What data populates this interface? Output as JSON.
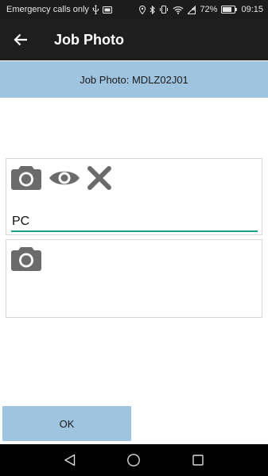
{
  "status_bar": {
    "carrier_text": "Emergency calls only",
    "battery_percent": "72%",
    "time": "09:15",
    "icons": [
      "usb-icon",
      "sim-icon",
      "location-icon",
      "bluetooth-icon",
      "vibrate-icon",
      "wifi-icon",
      "signal-icon",
      "battery-icon"
    ]
  },
  "app_bar": {
    "title": "Job Photo",
    "back_icon": "arrow-back-icon"
  },
  "sub_header": {
    "text": "Job Photo: MDLZ02J01"
  },
  "photo_card_1": {
    "icons": [
      "camera-icon",
      "eye-icon",
      "close-icon"
    ],
    "input_value": "PC"
  },
  "photo_card_2": {
    "icons": [
      "camera-icon"
    ]
  },
  "footer": {
    "ok_label": "OK"
  },
  "nav_bar": {
    "icons": [
      "back-triangle-icon",
      "home-circle-icon",
      "recents-square-icon"
    ]
  },
  "colors": {
    "accent": "#9ec4e0",
    "underline": "#17a08a",
    "icon_gray": "#6b6b6b"
  }
}
